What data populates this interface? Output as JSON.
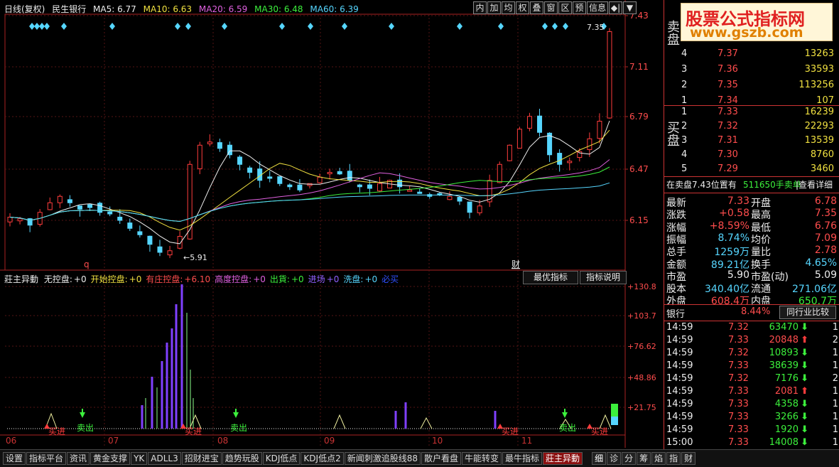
{
  "header": {
    "title": "日线(复权)",
    "stock": "民生银行",
    "ma5": "MA5: 6.77",
    "ma10": "MA10: 6.63",
    "ma20": "MA20: 6.59",
    "ma30": "MA30: 6.48",
    "ma60": "MA60: 6.39",
    "buttons": [
      "内",
      "加",
      "均",
      "权",
      "叠",
      "窗",
      "区",
      "预",
      "信息",
      "◆|",
      "▼"
    ]
  },
  "price_axis": [
    "7.43",
    "7.11",
    "6.79",
    "6.47",
    "6.15"
  ],
  "annotations": {
    "high": "7.35",
    "low": "5.91",
    "q": "q",
    "cai": "财"
  },
  "indicator": {
    "name": "莊主异動",
    "items": [
      {
        "label": "无控盘:",
        "value": "+0",
        "color": "#eeeeee"
      },
      {
        "label": "开始控盘:",
        "value": "+0",
        "color": "#f0e040"
      },
      {
        "label": "有庄控盘:",
        "value": "+6.10",
        "color": "#ff4d4d"
      },
      {
        "label": "高度控盘:",
        "value": "+0",
        "color": "#e060e0"
      },
      {
        "label": "出貨:",
        "value": "+0",
        "color": "#3cf03c"
      },
      {
        "label": "进场",
        "value": "+0",
        "color": "#9060ff"
      },
      {
        "label": "洗盘:",
        "value": "+0",
        "color": "#56d6ff"
      },
      {
        "label": "必买",
        "value": "",
        "color": "#3050ff"
      }
    ],
    "btn_best": "最优指标",
    "btn_desc": "指标说明",
    "axis": [
      "+130.8",
      "+103.7",
      "+76.62",
      "+48.86",
      "+21.75"
    ],
    "signals": {
      "buy": "买进",
      "sell": "卖出"
    }
  },
  "x_labels": [
    "06",
    "07",
    "08",
    "09",
    "10",
    "11"
  ],
  "bottom_tabs": [
    "设置",
    "指标平台",
    "资讯",
    "黄金支撑",
    "YK",
    "ADLL3",
    "招财进宝",
    "趋势玩股",
    "KDJ低点",
    "KDJ低点2",
    "新闻刺激追股线88",
    "散户看盘",
    "牛能转变",
    "最牛指标",
    "莊主异動"
  ],
  "bottom_tabs_right": [
    "细",
    "诊",
    "分",
    "筹",
    "焰",
    "指",
    "财"
  ],
  "watermark": {
    "title": "股票公式指标网",
    "url": "www.gszb.com"
  },
  "orderbook": {
    "sell_label": "卖盘",
    "buy_label": "买盘",
    "sell": [
      {
        "lvl": "4",
        "price": "7.37",
        "vol": "13263"
      },
      {
        "lvl": "3",
        "price": "7.36",
        "vol": "33593"
      },
      {
        "lvl": "2",
        "price": "7.35",
        "vol": "113256"
      },
      {
        "lvl": "1",
        "price": "7.34",
        "vol": "107"
      }
    ],
    "buy": [
      {
        "lvl": "1",
        "price": "7.33",
        "vol": "16239"
      },
      {
        "lvl": "2",
        "price": "7.32",
        "vol": "22293"
      },
      {
        "lvl": "3",
        "price": "7.31",
        "vol": "13539"
      },
      {
        "lvl": "4",
        "price": "7.30",
        "vol": "8760"
      },
      {
        "lvl": "5",
        "price": "7.29",
        "vol": "3460"
      }
    ],
    "notice_a": "在卖盘7.43位置有",
    "notice_b": "511650手卖单",
    "notice_c": "|查看详细"
  },
  "quote": [
    {
      "l1": "最新",
      "v1": "7.33",
      "c1": "red",
      "l2": "开盘",
      "v2": "6.78",
      "c2": "red"
    },
    {
      "l1": "涨跌",
      "v1": "+0.58",
      "c1": "red",
      "l2": "最高",
      "v2": "7.35",
      "c2": "red"
    },
    {
      "l1": "涨幅",
      "v1": "+8.59%",
      "c1": "red",
      "l2": "最低",
      "v2": "6.76",
      "c2": "red"
    },
    {
      "l1": "振幅",
      "v1": "8.74%",
      "c1": "cyan",
      "l2": "均价",
      "v2": "7.09",
      "c2": "red"
    },
    {
      "l1": "总手",
      "v1": "1259万",
      "c1": "cyan",
      "l2": "量比",
      "v2": "2.78",
      "c2": "red"
    },
    {
      "l1": "金额",
      "v1": "89.21亿",
      "c1": "cyan",
      "l2": "换手",
      "v2": "4.65%",
      "c2": "cyan"
    },
    {
      "l1": "市盈",
      "v1": "5.90",
      "c1": "white",
      "l2": "市盈(动)",
      "v2": "5.09",
      "c2": "white"
    },
    {
      "l1": "股本",
      "v1": "340.40亿",
      "c1": "cyan",
      "l2": "流通",
      "v2": "271.06亿",
      "c2": "cyan"
    },
    {
      "l1": "外盘",
      "v1": "608.4万",
      "c1": "red",
      "l2": "内盘",
      "v2": "650.7万",
      "c2": "green"
    }
  ],
  "industry": {
    "name": "银行",
    "pct": "8.44%",
    "btn": "同行业比较"
  },
  "ticks": [
    {
      "t": "14:59",
      "p": "7.32",
      "v": "63470",
      "d": "down",
      "n": "1"
    },
    {
      "t": "14:59",
      "p": "7.33",
      "v": "20848",
      "d": "up",
      "n": "2"
    },
    {
      "t": "14:59",
      "p": "7.32",
      "v": "10893",
      "d": "down",
      "n": "1"
    },
    {
      "t": "14:59",
      "p": "7.33",
      "v": "38639",
      "d": "down",
      "n": "1"
    },
    {
      "t": "14:59",
      "p": "7.32",
      "v": "7176",
      "d": "down",
      "n": "2"
    },
    {
      "t": "14:59",
      "p": "7.33",
      "v": "2081",
      "d": "up",
      "n": "1"
    },
    {
      "t": "14:59",
      "p": "7.33",
      "v": "4358",
      "d": "down",
      "n": "1"
    },
    {
      "t": "14:59",
      "p": "7.33",
      "v": "3266",
      "d": "down",
      "n": "1"
    },
    {
      "t": "14:59",
      "p": "7.33",
      "v": "1920",
      "d": "down",
      "n": "1"
    },
    {
      "t": "15:00",
      "p": "7.33",
      "v": "14008",
      "d": "down",
      "n": "1"
    }
  ],
  "colors": {
    "up": "#ff3c3c",
    "down": "#3cf03c",
    "accent_red": "#cc3333",
    "cyan": "#56d6ff"
  }
}
